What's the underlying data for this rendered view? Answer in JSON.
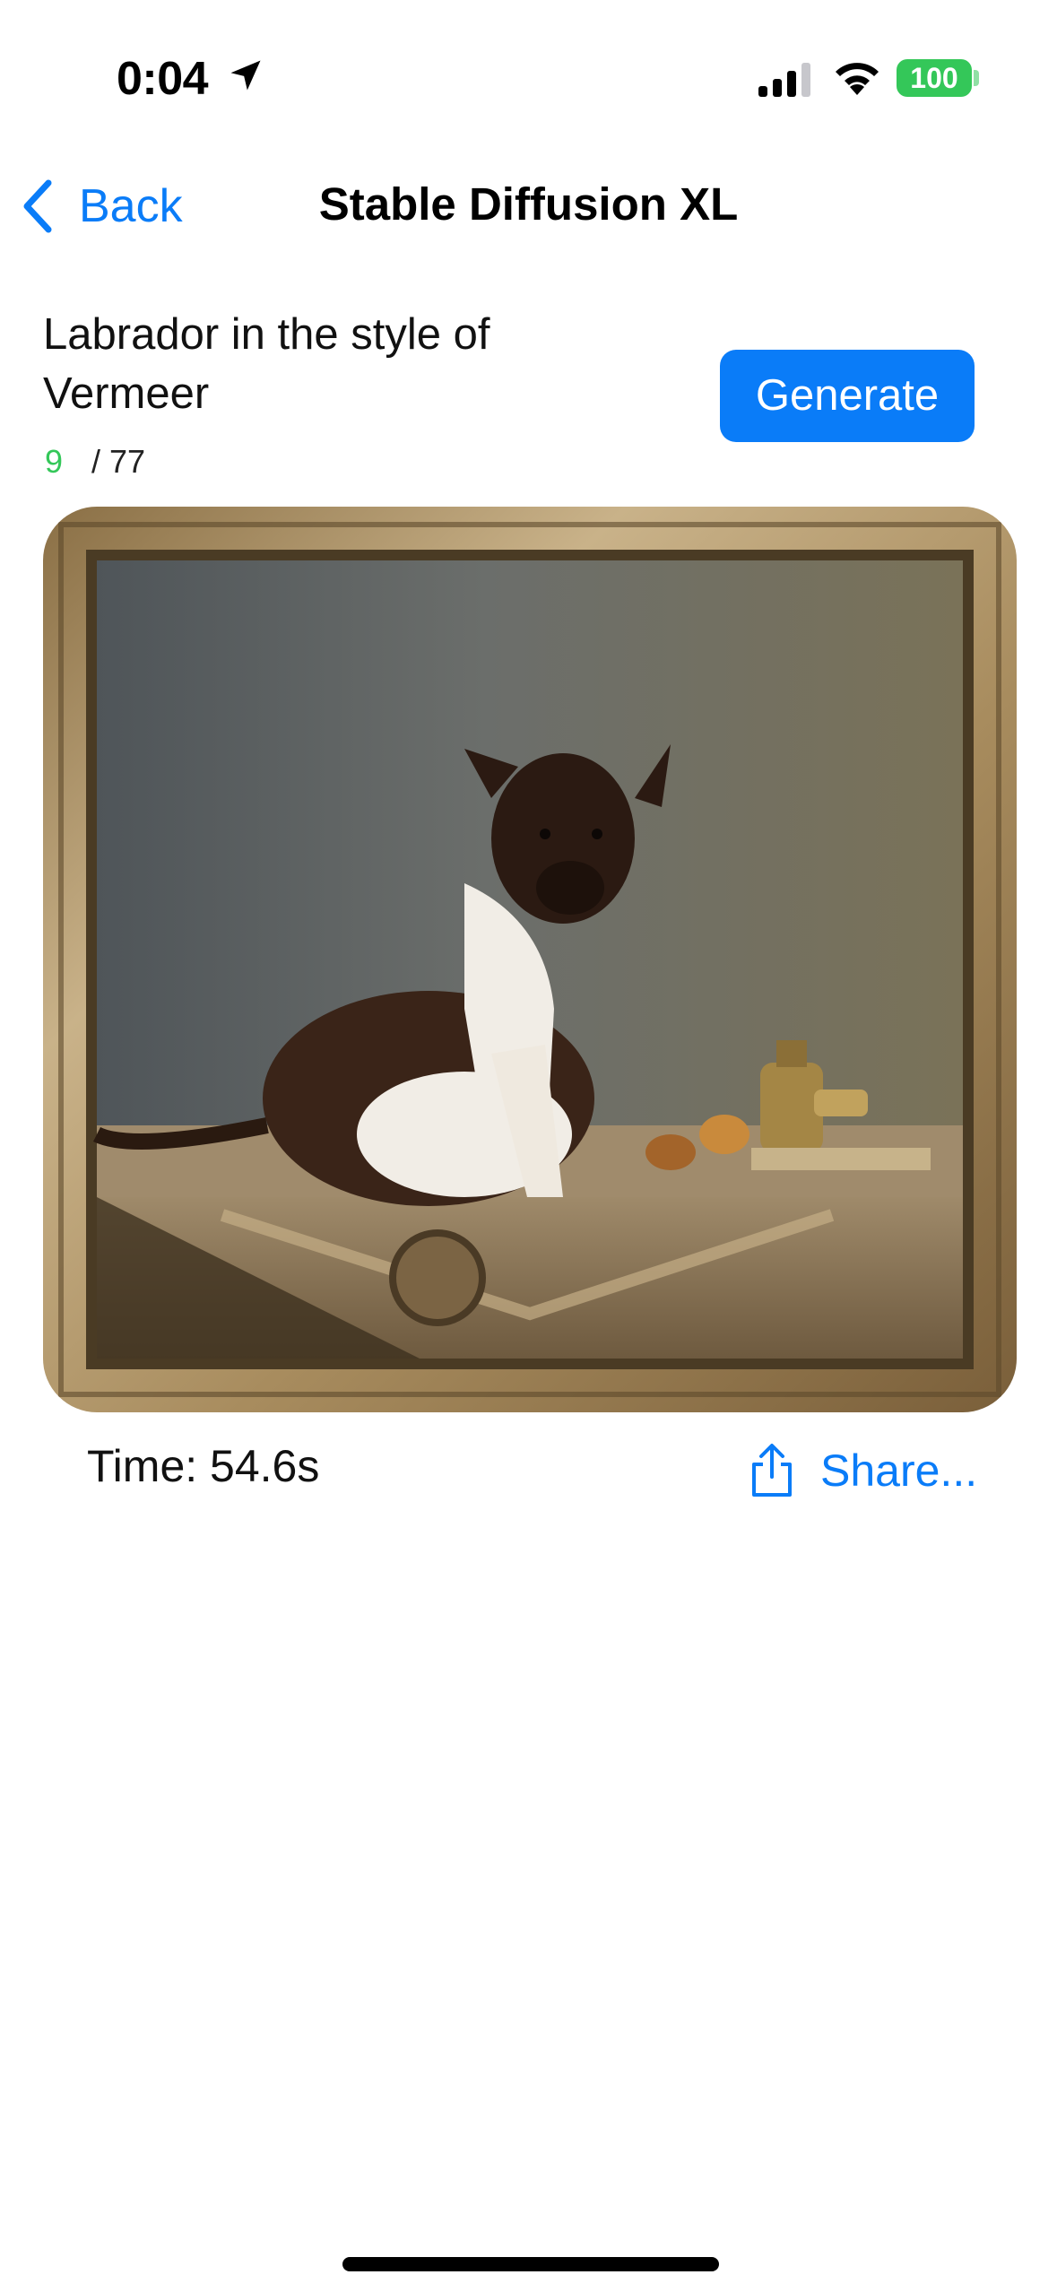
{
  "status_bar": {
    "time": "0:04",
    "battery": "100",
    "icons": [
      "location-arrow-icon",
      "cellular-signal-icon",
      "wifi-icon",
      "battery-icon"
    ]
  },
  "nav": {
    "back_label": "Back",
    "title": "Stable Diffusion XL"
  },
  "prompt": {
    "text": "Labrador in the style of Vermeer",
    "count": "9",
    "limit": "/ 77"
  },
  "generate_label": "Generate",
  "result": {
    "time_label": "Time: 54.6s",
    "share_label": "Share..."
  },
  "colors": {
    "accent": "#0a7cf8",
    "success": "#34c759"
  }
}
